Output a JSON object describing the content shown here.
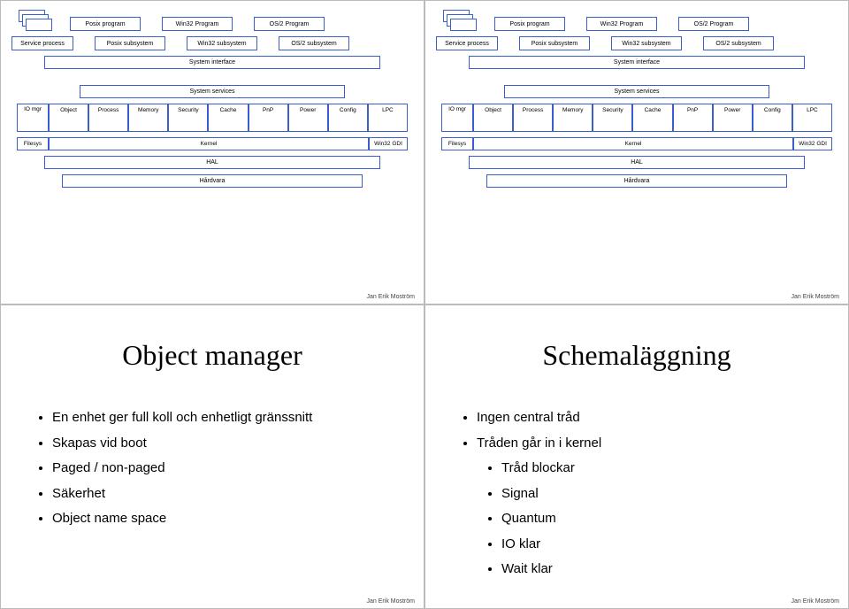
{
  "author": "Jan Erik Moström",
  "arch": {
    "programs": [
      "Posix program",
      "Win32 Program",
      "OS/2 Program"
    ],
    "programs_right": [
      "Posix program",
      "Win32 Program",
      "OS/2 Program"
    ],
    "service_process": "Service process",
    "subsystems": [
      "Posix subsystem",
      "Win32 subsystem",
      "OS/2 subsystem"
    ],
    "system_interface": "System interface",
    "system_services": "System services",
    "io_mgr": "IO mgr",
    "managers": [
      "Object",
      "Process",
      "Memory",
      "Security",
      "Cache",
      "PnP",
      "Power",
      "Config",
      "LPC"
    ],
    "filesys": "Filesys",
    "kernel": "Kernel",
    "win32gdi": "Win32 GDI",
    "hal": "HAL",
    "hardware": "Hårdvara"
  },
  "slide3": {
    "title": "Object manager",
    "bullets": [
      "En enhet ger full koll och enhetligt gränssnitt",
      "Skapas vid boot",
      "Paged / non-paged",
      "Säkerhet",
      "Object name space"
    ]
  },
  "slide4": {
    "title": "Schemaläggning",
    "bullets": [
      "Ingen central tråd",
      "Tråden går in i kernel"
    ],
    "sub": [
      "Tråd blockar",
      "Signal",
      "Quantum",
      "IO klar",
      "Wait klar"
    ]
  }
}
